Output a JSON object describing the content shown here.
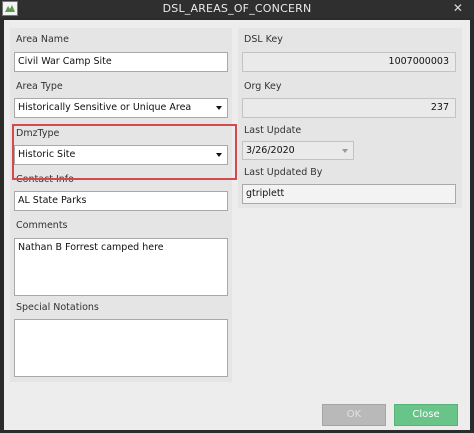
{
  "window": {
    "title": "DSL_AREAS_OF_CONCERN",
    "close_glyph": "✕",
    "icons": {
      "app": "app-icon",
      "close": "close-icon"
    }
  },
  "form": {
    "area_name": {
      "label": "Area Name",
      "value": "Civil War Camp Site"
    },
    "area_type": {
      "label": "Area Type",
      "value": "Historically Sensitive or Unique Area"
    },
    "dmz_type": {
      "label": "DmzType",
      "value": "Historic Site"
    },
    "contact_info": {
      "label": "Contact Info",
      "value": "AL State Parks"
    },
    "comments": {
      "label": "Comments",
      "value": "Nathan B Forrest camped here"
    },
    "special_notations": {
      "label": "Special Notations",
      "value": ""
    },
    "dsl_key": {
      "label": "DSL Key",
      "value": "1007000003"
    },
    "org_key": {
      "label": "Org Key",
      "value": "237"
    },
    "last_update": {
      "label": "Last Update",
      "value": "3/26/2020"
    },
    "last_updated_by": {
      "label": "Last Updated By",
      "value": "gtriplett"
    }
  },
  "buttons": {
    "ok": "OK",
    "close": "Close"
  },
  "colors": {
    "highlight": "#d34a4a",
    "close_button": "#69c489",
    "ok_button": "#b9b9b9",
    "titlebar": "#2f2f2f"
  }
}
